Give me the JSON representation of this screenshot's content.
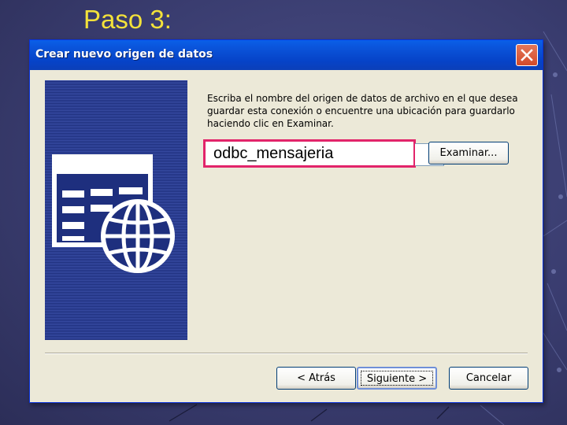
{
  "slide": {
    "title": "Paso 3:"
  },
  "window": {
    "title": "Crear nuevo origen de datos",
    "close_icon": "close-icon"
  },
  "instructions": "Escriba el nombre del origen de datos de archivo en el que desea guardar esta conexión o encuentre una ubicación para guardarlo haciendo clic en Examinar.",
  "name_input": {
    "value": "odbc_mensajeria"
  },
  "buttons": {
    "examinar": "Examinar...",
    "atras": "< Atrás",
    "siguiente": "Siguiente >",
    "cancelar": "Cancelar"
  },
  "colors": {
    "title_text": "#f3e23a",
    "titlebar": "#0a52d8",
    "highlight_border": "#e2246a",
    "side_panel": "#2a3b92"
  }
}
